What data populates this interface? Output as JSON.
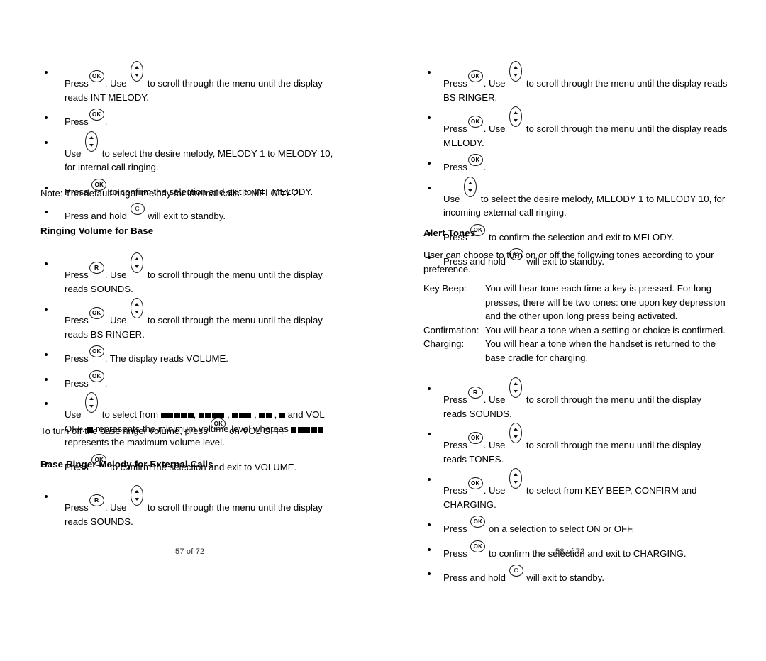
{
  "document": {
    "type": "cordless-phone-user-manual",
    "spread": "two-page",
    "icons": {
      "ok": "OK",
      "r": "R",
      "c": "C",
      "scroll": "scroll-up-down-key"
    }
  },
  "left_page": {
    "footer": "57 of 72",
    "bullets_top": [
      {
        "id": "l-b1",
        "parts": [
          {
            "t": "text",
            "v": "Press"
          },
          {
            "t": "key",
            "v": "ok"
          },
          {
            "t": "text",
            "v": ". Use "
          },
          {
            "t": "key",
            "v": "scroll"
          },
          {
            "t": "text",
            "v": " to scroll through the menu until the display reads INT MELODY."
          }
        ]
      },
      {
        "id": "l-b2",
        "parts": [
          {
            "t": "text",
            "v": "Press"
          },
          {
            "t": "key",
            "v": "ok"
          },
          {
            "t": "text",
            "v": "."
          }
        ]
      },
      {
        "id": "l-b3",
        "parts": [
          {
            "t": "text",
            "v": "Use "
          },
          {
            "t": "key",
            "v": "scroll"
          },
          {
            "t": "text",
            "v": " to select the desire melody, MELODY 1 to MELODY 10, for internal call ringing."
          }
        ]
      },
      {
        "id": "l-b4",
        "parts": [
          {
            "t": "text",
            "v": "Press "
          },
          {
            "t": "key",
            "v": "ok"
          },
          {
            "t": "text",
            "v": " to confirm the selection and exit to INT MELODY."
          }
        ]
      },
      {
        "id": "l-b5",
        "parts": [
          {
            "t": "text",
            "v": "Press and hold "
          },
          {
            "t": "key",
            "v": "c"
          },
          {
            "t": "text",
            "v": " will exit to standby."
          }
        ]
      }
    ],
    "note": "Note: The default ringer melody for internal calls is MELODY 2.",
    "heading_volume": "Ringing Volume for Base",
    "bullets_volume": [
      {
        "id": "l-v1",
        "parts": [
          {
            "t": "text",
            "v": "Press"
          },
          {
            "t": "key",
            "v": "r"
          },
          {
            "t": "text",
            "v": ". Use "
          },
          {
            "t": "key",
            "v": "scroll"
          },
          {
            "t": "text",
            "v": " to scroll through the menu until the display reads SOUNDS."
          }
        ]
      },
      {
        "id": "l-v2",
        "parts": [
          {
            "t": "text",
            "v": "Press"
          },
          {
            "t": "key",
            "v": "ok"
          },
          {
            "t": "text",
            "v": ". Use "
          },
          {
            "t": "key",
            "v": "scroll"
          },
          {
            "t": "text",
            "v": " to scroll through the menu until the display reads BS RINGER."
          }
        ]
      },
      {
        "id": "l-v3",
        "parts": [
          {
            "t": "text",
            "v": "Press"
          },
          {
            "t": "key",
            "v": "ok"
          },
          {
            "t": "text",
            "v": ". The display reads VOLUME."
          }
        ]
      },
      {
        "id": "l-v4",
        "parts": [
          {
            "t": "text",
            "v": "Press"
          },
          {
            "t": "key",
            "v": "ok"
          },
          {
            "t": "text",
            "v": "."
          }
        ]
      },
      {
        "id": "l-v5",
        "parts": [
          {
            "t": "text",
            "v": "Use "
          },
          {
            "t": "key",
            "v": "scroll"
          },
          {
            "t": "text",
            "v": " to select from "
          },
          {
            "t": "vol",
            "v": 5
          },
          {
            "t": "text",
            "v": ", "
          },
          {
            "t": "vol",
            "v": 4
          },
          {
            "t": "text",
            "v": " , "
          },
          {
            "t": "vol",
            "v": 3
          },
          {
            "t": "text",
            "v": " , "
          },
          {
            "t": "vol",
            "v": 2
          },
          {
            "t": "text",
            "v": " , "
          },
          {
            "t": "vol",
            "v": 1
          },
          {
            "t": "text",
            "v": "  and VOL OFF. "
          },
          {
            "t": "vol",
            "v": 1
          },
          {
            "t": "text",
            "v": "  represents the minimum volume level whereas "
          },
          {
            "t": "vol",
            "v": 5
          },
          {
            "t": "text",
            "v": " represents the maximum volume level."
          }
        ]
      },
      {
        "id": "l-v6",
        "parts": [
          {
            "t": "text",
            "v": "Press "
          },
          {
            "t": "key",
            "v": "ok"
          },
          {
            "t": "text",
            "v": " to confirm the selection and exit to VOLUME."
          }
        ]
      }
    ],
    "voloff_line": [
      {
        "t": "text",
        "v": "To turn off the base ringer volume, press "
      },
      {
        "t": "key",
        "v": "ok"
      },
      {
        "t": "text",
        "v": " on VOL OFF."
      }
    ],
    "heading_base_melody": "Base Ringer Melody for External Calls",
    "bullets_base_melody": [
      {
        "id": "l-m1",
        "parts": [
          {
            "t": "text",
            "v": "Press"
          },
          {
            "t": "key",
            "v": "r"
          },
          {
            "t": "text",
            "v": ". Use "
          },
          {
            "t": "key",
            "v": "scroll"
          },
          {
            "t": "text",
            "v": " to scroll through the menu until the display reads SOUNDS."
          }
        ]
      }
    ]
  },
  "right_page": {
    "footer": "58 of 72",
    "bullets_top": [
      {
        "id": "r-b1",
        "parts": [
          {
            "t": "text",
            "v": "Press"
          },
          {
            "t": "key",
            "v": "ok"
          },
          {
            "t": "text",
            "v": ". Use "
          },
          {
            "t": "key",
            "v": "scroll"
          },
          {
            "t": "text",
            "v": " to scroll through the menu until the display reads BS RINGER."
          }
        ]
      },
      {
        "id": "r-b2",
        "parts": [
          {
            "t": "text",
            "v": "Press"
          },
          {
            "t": "key",
            "v": "ok"
          },
          {
            "t": "text",
            "v": ". Use "
          },
          {
            "t": "key",
            "v": "scroll"
          },
          {
            "t": "text",
            "v": " to scroll through the menu until the display reads MELODY."
          }
        ]
      },
      {
        "id": "r-b3",
        "parts": [
          {
            "t": "text",
            "v": "Press"
          },
          {
            "t": "key",
            "v": "ok"
          },
          {
            "t": "text",
            "v": "."
          }
        ]
      },
      {
        "id": "r-b4",
        "parts": [
          {
            "t": "text",
            "v": "Use "
          },
          {
            "t": "key",
            "v": "scroll"
          },
          {
            "t": "text",
            "v": " to select the desire melody, MELODY 1 to MELODY 10, for incoming external call ringing."
          }
        ]
      },
      {
        "id": "r-b5",
        "parts": [
          {
            "t": "text",
            "v": "Press "
          },
          {
            "t": "key",
            "v": "ok"
          },
          {
            "t": "text",
            "v": " to confirm the selection and exit to MELODY."
          }
        ]
      },
      {
        "id": "r-b6",
        "parts": [
          {
            "t": "text",
            "v": "Press and hold "
          },
          {
            "t": "key",
            "v": "c"
          },
          {
            "t": "text",
            "v": " will exit to standby."
          }
        ]
      }
    ],
    "heading_alert_tones": "Alert Tones",
    "alert_intro": "User can choose to turn on or off the following tones according to your preference.",
    "tone_definitions": [
      {
        "term": "Key Beep:",
        "desc": "You will hear tone each time a key is pressed. For long presses, there will be two tones: one upon key depression and the other upon long press being activated."
      },
      {
        "term": "Confirmation:",
        "desc": "You will hear a tone when a setting or choice is confirmed."
      },
      {
        "term": "Charging:",
        "desc": "You will hear a tone when the handset is returned to the base cradle for charging."
      }
    ],
    "bullets_tones": [
      {
        "id": "r-t1",
        "parts": [
          {
            "t": "text",
            "v": "Press"
          },
          {
            "t": "key",
            "v": "r"
          },
          {
            "t": "text",
            "v": ". Use "
          },
          {
            "t": "key",
            "v": "scroll"
          },
          {
            "t": "text",
            "v": " to scroll through the menu until the display reads SOUNDS."
          }
        ]
      },
      {
        "id": "r-t2",
        "parts": [
          {
            "t": "text",
            "v": "Press"
          },
          {
            "t": "key",
            "v": "ok"
          },
          {
            "t": "text",
            "v": ". Use "
          },
          {
            "t": "key",
            "v": "scroll"
          },
          {
            "t": "text",
            "v": " to scroll through the menu until the display reads TONES."
          }
        ]
      },
      {
        "id": "r-t3",
        "parts": [
          {
            "t": "text",
            "v": "Press"
          },
          {
            "t": "key",
            "v": "ok"
          },
          {
            "t": "text",
            "v": ". Use "
          },
          {
            "t": "key",
            "v": "scroll"
          },
          {
            "t": "text",
            "v": " to select from KEY BEEP, CONFIRM and CHARGING."
          }
        ]
      },
      {
        "id": "r-t4",
        "parts": [
          {
            "t": "text",
            "v": "Press "
          },
          {
            "t": "key",
            "v": "ok"
          },
          {
            "t": "text",
            "v": " on a selection to select ON or OFF."
          }
        ]
      },
      {
        "id": "r-t5",
        "parts": [
          {
            "t": "text",
            "v": "Press "
          },
          {
            "t": "key",
            "v": "ok"
          },
          {
            "t": "text",
            "v": " to confirm the selection and exit to CHARGING."
          }
        ]
      },
      {
        "id": "r-t6",
        "parts": [
          {
            "t": "text",
            "v": "Press and hold "
          },
          {
            "t": "key",
            "v": "c"
          },
          {
            "t": "text",
            "v": " will exit to standby."
          }
        ]
      }
    ]
  }
}
